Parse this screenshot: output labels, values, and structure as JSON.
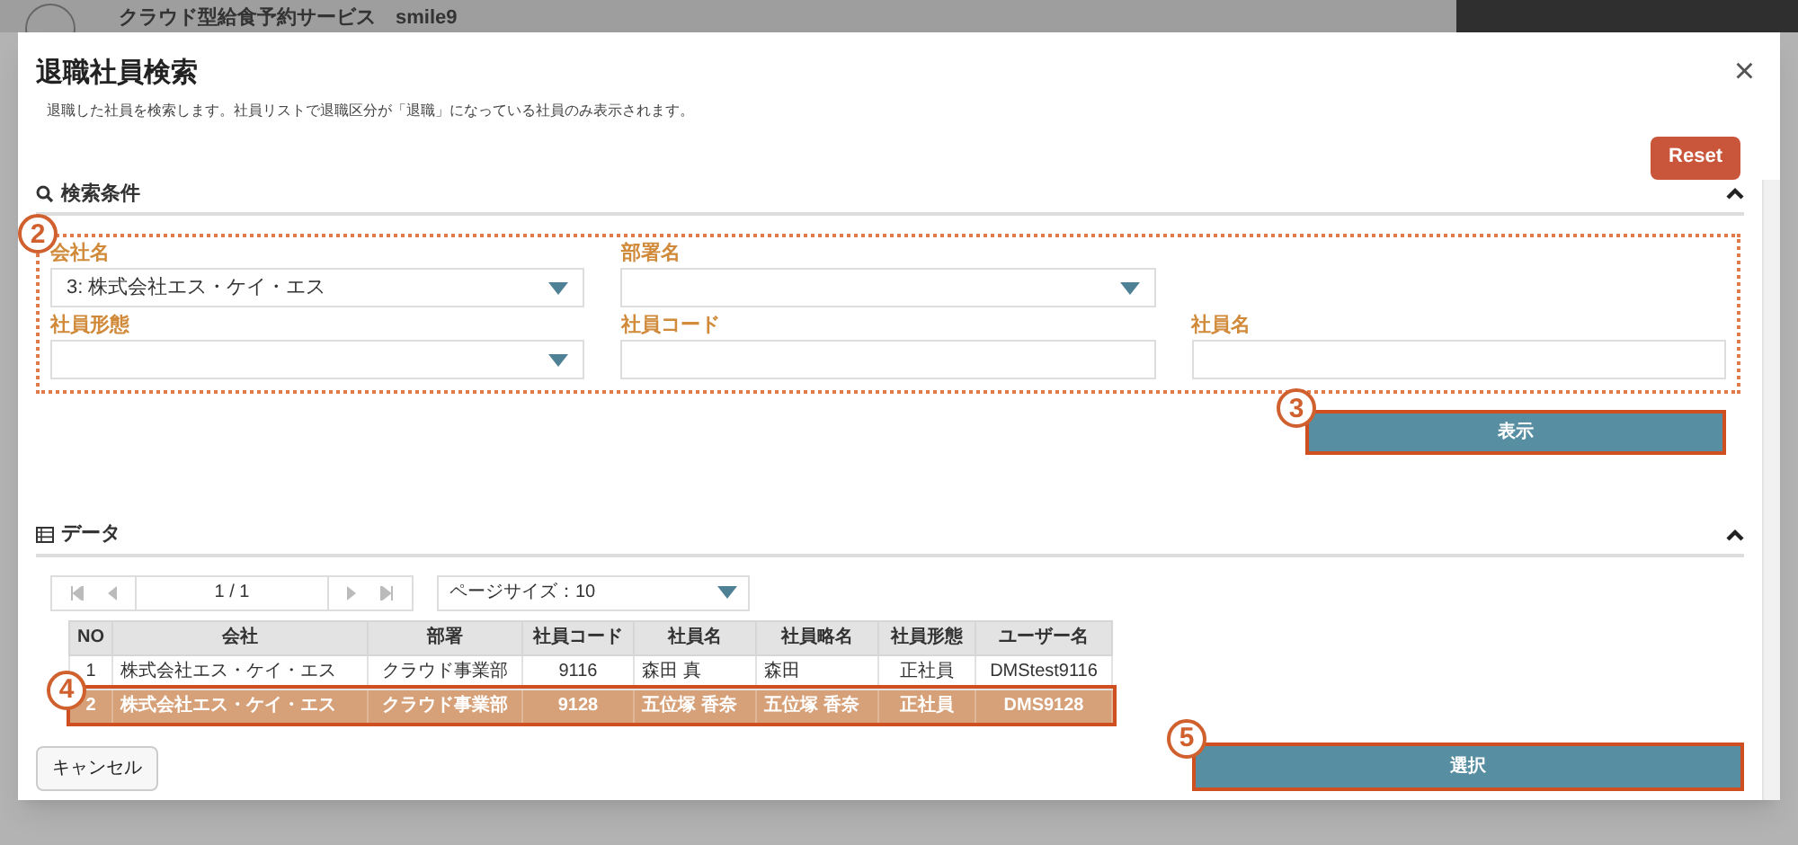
{
  "background": {
    "app_title": "クラウド型給食予約サービス　smile9"
  },
  "dialog": {
    "title": "退職社員検索",
    "description": "退職した社員を検索します。社員リストで退職区分が「退職」になっている社員のみ表示されます。",
    "close": "×",
    "reset": "Reset"
  },
  "search": {
    "title": "検索条件",
    "marker": "2",
    "fields": [
      {
        "label": "会社名",
        "kind": "select",
        "value": "3: 株式会社エス・ケイ・エス"
      },
      {
        "label": "部署名",
        "kind": "select"
      },
      {
        "label": "社員形態",
        "kind": "select"
      },
      {
        "label": "社員コード",
        "kind": "text"
      },
      {
        "label": "社員名",
        "kind": "text"
      }
    ],
    "show_button": "表示",
    "show_marker": "3"
  },
  "data": {
    "title": "データ",
    "page": "1 / 1",
    "page_size": "ページサイズ：10",
    "columns": [
      "NO",
      "会社",
      "部署",
      "社員コード",
      "社員名",
      "社員略名",
      "社員形態",
      "ユーザー名"
    ],
    "rows": [
      {
        "cells": [
          "1",
          "株式会社エス・ケイ・エス",
          "クラウド事業部",
          "9116",
          "森田 真",
          "森田",
          "正社員",
          "DMStest9116"
        ],
        "selected": false
      },
      {
        "cells": [
          "2",
          "株式会社エス・ケイ・エス",
          "クラウド事業部",
          "9128",
          "五位塚 香奈",
          "五位塚 香奈",
          "正社員",
          "DMS9128"
        ],
        "selected": true
      }
    ],
    "row_marker": "4"
  },
  "footer": {
    "cancel": "キャンセル",
    "select": "選択",
    "select_marker": "5"
  }
}
